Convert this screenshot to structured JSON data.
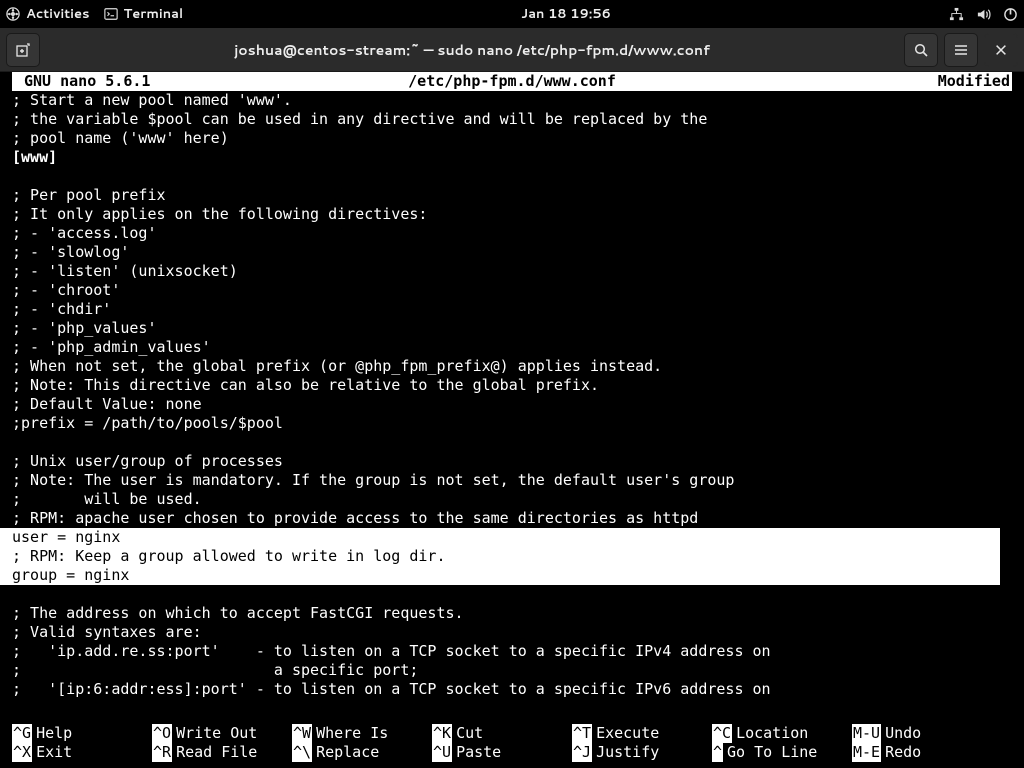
{
  "topbar": {
    "activities": "Activities",
    "app": "Terminal",
    "clock": "Jan 18  19:56"
  },
  "headerbar": {
    "title": "joshua@centos-stream:~ — sudo nano /etc/php-fpm.d/www.conf"
  },
  "nano": {
    "version": " GNU nano 5.6.1",
    "filename": "/etc/php-fpm.d/www.conf",
    "modified": "Modified "
  },
  "body_top": "; Start a new pool named 'www'.\n; the variable $pool can be used in any directive and will be replaced by the\n; pool name ('www' here)",
  "section": "[www]",
  "body_mid": "\n; Per pool prefix\n; It only applies on the following directives:\n; - 'access.log'\n; - 'slowlog'\n; - 'listen' (unixsocket)\n; - 'chroot'\n; - 'chdir'\n; - 'php_values'\n; - 'php_admin_values'\n; When not set, the global prefix (or @php_fpm_prefix@) applies instead.\n; Note: This directive can also be relative to the global prefix.\n; Default Value: none\n;prefix = /path/to/pools/$pool\n\n; Unix user/group of processes\n; Note: The user is mandatory. If the group is not set, the default user's group\n;       will be used.\n; RPM: apache user chosen to provide access to the same directories as httpd",
  "sel1": "user = nginx",
  "sel2": "; RPM: Keep a group allowed to write in log dir.",
  "sel3": "group = nginx",
  "body_bot": "\n; The address on which to accept FastCGI requests.\n; Valid syntaxes are:\n;   'ip.add.re.ss:port'    - to listen on a TCP socket to a specific IPv4 address on\n;                            a specific port;\n;   '[ip:6:addr:ess]:port' - to listen on a TCP socket to a specific IPv6 address on",
  "shortcuts": {
    "row1": [
      {
        "key": "^G",
        "label": "Help"
      },
      {
        "key": "^O",
        "label": "Write Out"
      },
      {
        "key": "^W",
        "label": "Where Is"
      },
      {
        "key": "^K",
        "label": "Cut"
      },
      {
        "key": "^T",
        "label": "Execute"
      },
      {
        "key": "^C",
        "label": "Location"
      },
      {
        "key": "M-U",
        "label": "Undo"
      }
    ],
    "row2": [
      {
        "key": "^X",
        "label": "Exit"
      },
      {
        "key": "^R",
        "label": "Read File"
      },
      {
        "key": "^\\",
        "label": "Replace"
      },
      {
        "key": "^U",
        "label": "Paste"
      },
      {
        "key": "^J",
        "label": "Justify"
      },
      {
        "key": "^ ",
        "label": "Go To Line"
      },
      {
        "key": "M-E",
        "label": "Redo"
      }
    ]
  }
}
